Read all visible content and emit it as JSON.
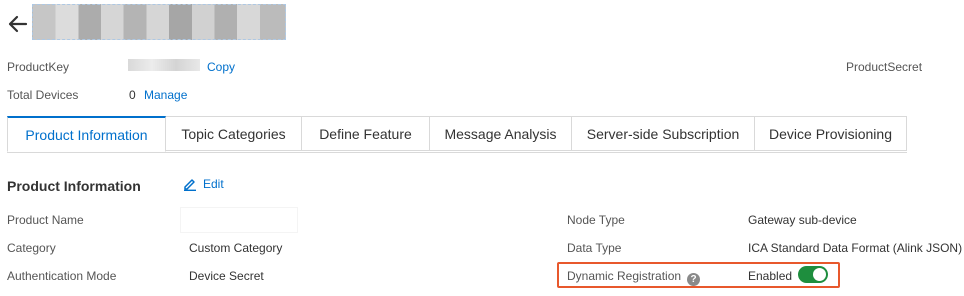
{
  "header": {
    "back_icon": "arrow-left-icon"
  },
  "summary": {
    "product_key_label": "ProductKey",
    "copy_label": "Copy",
    "product_secret_label": "ProductSecret",
    "total_devices_label": "Total Devices",
    "total_devices_value": "0",
    "manage_label": "Manage"
  },
  "tabs": [
    {
      "label": "Product Information",
      "active": true
    },
    {
      "label": "Topic Categories"
    },
    {
      "label": "Define Feature"
    },
    {
      "label": "Message Analysis"
    },
    {
      "label": "Server-side Subscription"
    },
    {
      "label": "Device Provisioning"
    }
  ],
  "product_info": {
    "title": "Product Information",
    "edit_label": "Edit",
    "edit_icon": "pencil-icon",
    "fields": {
      "product_name_label": "Product Name",
      "product_name_value": "",
      "category_label": "Category",
      "category_value": "Custom Category",
      "auth_mode_label": "Authentication Mode",
      "auth_mode_value": "Device Secret",
      "node_type_label": "Node Type",
      "node_type_value": "Gateway sub-device",
      "data_type_label": "Data Type",
      "data_type_value": "ICA Standard Data Format (Alink JSON)",
      "dynamic_reg_label": "Dynamic Registration",
      "dynamic_reg_help": "?",
      "dynamic_reg_value": "Enabled",
      "dynamic_reg_enabled": true
    }
  },
  "colors": {
    "link": "#0070cc",
    "toggle_on": "#1e8e3e",
    "highlight_border": "#e8582c"
  }
}
